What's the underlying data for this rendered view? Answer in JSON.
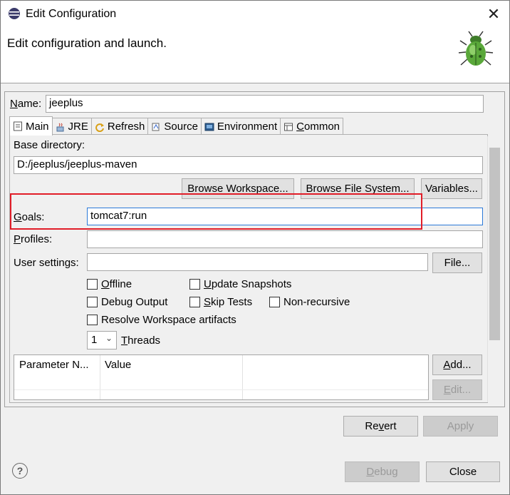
{
  "window": {
    "title": "Edit Configuration",
    "banner_message": "Edit configuration and launch."
  },
  "name": {
    "label": "Name:",
    "value": "jeeplus"
  },
  "tabs": [
    {
      "label": "Main",
      "icon": "main-tab-icon"
    },
    {
      "label": "JRE",
      "icon": "jre-tab-icon"
    },
    {
      "label": "Refresh",
      "icon": "refresh-tab-icon"
    },
    {
      "label": "Source",
      "icon": "source-tab-icon"
    },
    {
      "label": "Environment",
      "icon": "environment-tab-icon"
    },
    {
      "label": "Common",
      "icon": "common-tab-icon"
    }
  ],
  "main": {
    "base_dir_label": "Base directory:",
    "base_dir_value": "D:/jeeplus/jeeplus-maven",
    "browse_workspace": "Browse Workspace...",
    "browse_filesystem": "Browse File System...",
    "variables": "Variables...",
    "goals_label": "Goals:",
    "goals_value": "tomcat7:run",
    "profiles_label": "Profiles:",
    "profiles_value": "",
    "user_settings_label": "User settings:",
    "user_settings_value": "",
    "file_button": "File...",
    "offline": "Offline",
    "update_snapshots": "Update Snapshots",
    "debug_output": "Debug Output",
    "skip_tests": "Skip Tests",
    "non_recursive": "Non-recursive",
    "resolve_workspace": "Resolve Workspace artifacts",
    "threads_value": "1",
    "threads_label": "Threads",
    "table_headers": [
      "Parameter N...",
      "Value"
    ],
    "add_button": "Add...",
    "edit_button": "Edit..."
  },
  "buttons": {
    "revert": "Revert",
    "apply": "Apply",
    "debug": "Debug",
    "close": "Close"
  },
  "colors": {
    "highlight_box": "#e11d28",
    "focus_border": "#2b79d8"
  }
}
